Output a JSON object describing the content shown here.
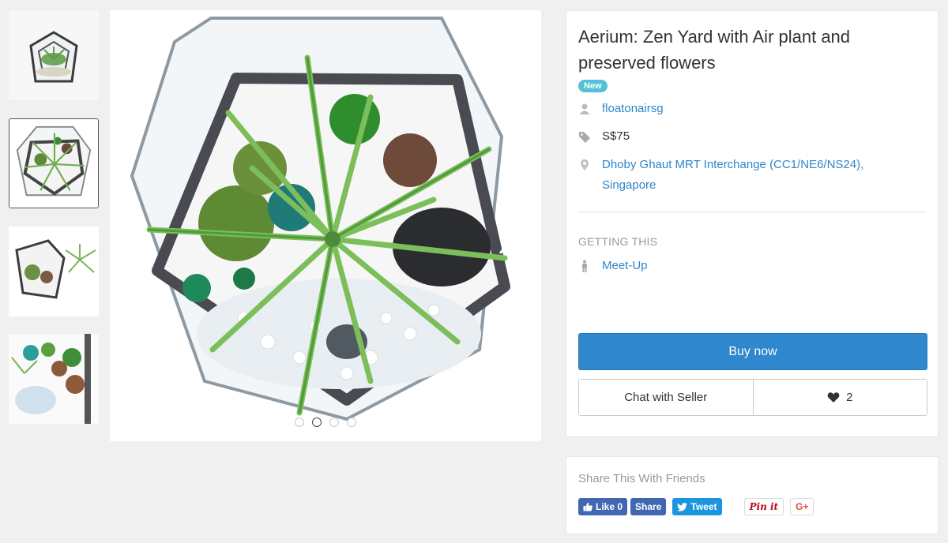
{
  "listing": {
    "title": "Aerium: Zen Yard with Air plant and preserved flowers",
    "condition_badge": "New",
    "seller": "floatonairsg",
    "price": "S$75",
    "location": "Dhoby Ghaut MRT Interchange (CC1/NE6/NS24), Singapore"
  },
  "getting": {
    "label": "GETTING THIS",
    "method": "Meet-Up"
  },
  "actions": {
    "buy": "Buy now",
    "chat": "Chat with Seller",
    "likes": "2"
  },
  "share": {
    "title": "Share This With Friends",
    "fb_like": "Like 0",
    "fb_share": "Share",
    "tweet": "Tweet",
    "pin": "Pin it",
    "gplus": "G+"
  },
  "gallery": {
    "thumbnail_count": 4,
    "active_thumbnail": 2,
    "dot_count": 4,
    "active_dot": 2
  },
  "colors": {
    "accent": "#2f87cd",
    "link": "#2e86c9",
    "badge": "#53c1d6",
    "facebook": "#4267b2",
    "twitter": "#1b95e0"
  }
}
